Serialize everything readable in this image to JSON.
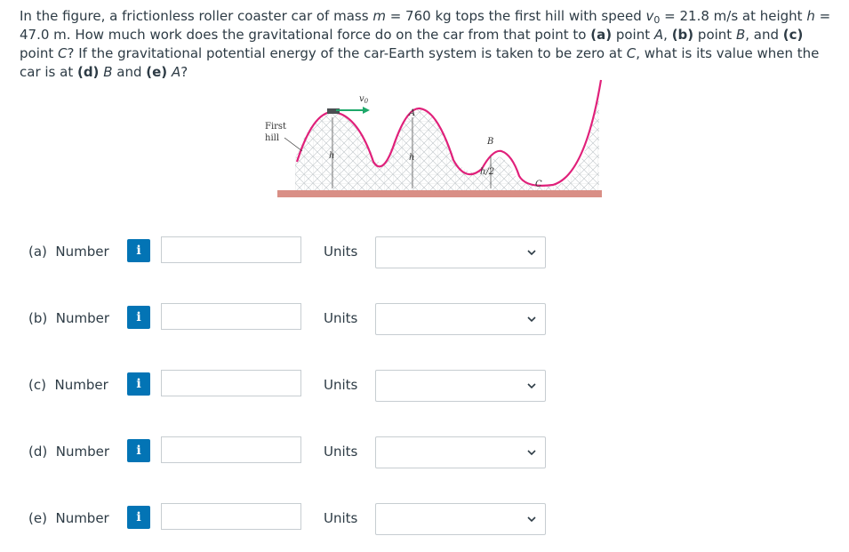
{
  "question": {
    "p1": "In the figure, a frictionless roller coaster car of mass ",
    "m_sym": "m",
    "p2": " = 760 kg tops the first hill with speed ",
    "v_sym": "v",
    "v_sub": "0",
    "p3": " = 21.8 m/s at height ",
    "h_sym": "h",
    "p4": " = 47.0 m. How much work does the gravitational force do on the car from that point to ",
    "a_tag": "(a)",
    "p5": " point ",
    "a_pt": "A",
    "p6": ", ",
    "b_tag": "(b)",
    "p7": " point ",
    "b_pt": "B",
    "p8": ", and ",
    "c_tag": "(c)",
    "p9": " point ",
    "c_pt": "C",
    "p10": "? If the gravitational potential energy of the car-Earth system is taken to be zero at ",
    "c_pt2": "C",
    "p11": ", what is its value when the car is at ",
    "d_tag": "(d)",
    "p12": " ",
    "b_pt2": "B",
    "p13": " and ",
    "e_tag": "(e)",
    "p14": " ",
    "a_pt2": "A",
    "p15": "?"
  },
  "figure": {
    "first_hill": "First",
    "first_hill2": "hill",
    "h_label": "h",
    "h_label2": "h",
    "half_h_label": "h/2",
    "point_a": "A",
    "point_b": "B",
    "point_c": "C",
    "v0_label": "v",
    "v0_sub": "0"
  },
  "colors": {
    "track": "#e0207a",
    "scaffold": "#9aa3a8",
    "ground": "#d98f86",
    "info_button": "#0374b5",
    "border": "#c7cdd1"
  },
  "rows": [
    {
      "label": "(a)  Number",
      "units_label": "Units",
      "value": "",
      "units_value": ""
    },
    {
      "label": "(b)  Number",
      "units_label": "Units",
      "value": "",
      "units_value": ""
    },
    {
      "label": "(c)  Number",
      "units_label": "Units",
      "value": "",
      "units_value": ""
    },
    {
      "label": "(d)  Number",
      "units_label": "Units",
      "value": "",
      "units_value": ""
    },
    {
      "label": "(e)  Number",
      "units_label": "Units",
      "value": "",
      "units_value": ""
    }
  ],
  "info_icon": "i"
}
